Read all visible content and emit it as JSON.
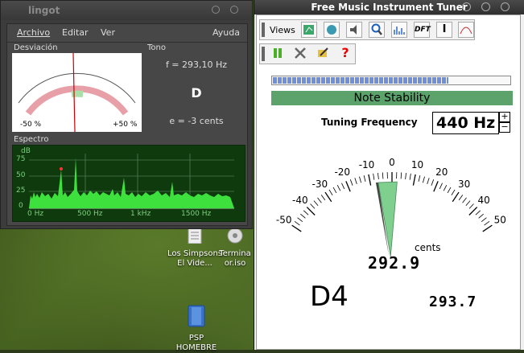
{
  "desktop": {
    "icons": [
      {
        "label": "Los Simpsons El Vide...",
        "name": "los-simpsons-file"
      },
      {
        "label": "Termina or.iso",
        "name": "terminator-iso-file"
      },
      {
        "label": "PSP HOMEBRE",
        "name": "psp-homebrew-folder"
      }
    ]
  },
  "lingot": {
    "title": "lingot",
    "menu": [
      "Archivo",
      "Editar",
      "Ver",
      "Ayuda"
    ],
    "desviacion_label": "Desviación",
    "tono_label": "Tono",
    "espectro_label": "Espectro",
    "gauge_min": "-50 %",
    "gauge_max": "+50 %",
    "frequency_text": "f = 293,10 Hz",
    "note": "D",
    "error_text": "e = -3 cents",
    "spectrum": {
      "y_unit": "dB",
      "y_ticks": [
        "75",
        "50",
        "25",
        "0"
      ],
      "x_ticks": [
        "0 Hz",
        "500 Hz",
        "1 kHz",
        "1500 Hz"
      ]
    }
  },
  "tuner": {
    "title": "Free Music Instrument Tuner",
    "views_label": "Views",
    "toolbar1_icons": [
      "chart-icon",
      "tuner-icon",
      "speaker-icon",
      "zoom-icon",
      "spectrum-icon",
      "dft-icon",
      "info-icon",
      "waveform-icon"
    ],
    "dft_label": "DFT",
    "toolbar2_icons": [
      "pause-icon",
      "tools-icon",
      "edit-icon",
      "help-icon"
    ],
    "level_fraction": 0.74,
    "stability_label": "Note Stability",
    "tuning_label": "Tuning Frequency",
    "tuning_value": "440 Hz",
    "spin_up": "+",
    "spin_down": "−",
    "dial_ticks": [
      "-50",
      "-40",
      "-30",
      "-20",
      "-10",
      "0",
      "10",
      "20",
      "30",
      "40",
      "50"
    ],
    "needle_cents": -2,
    "cents_label": "cents",
    "frequency_readout": "292.9",
    "note_readout": "D4",
    "secondary_readout": "293.7"
  }
}
